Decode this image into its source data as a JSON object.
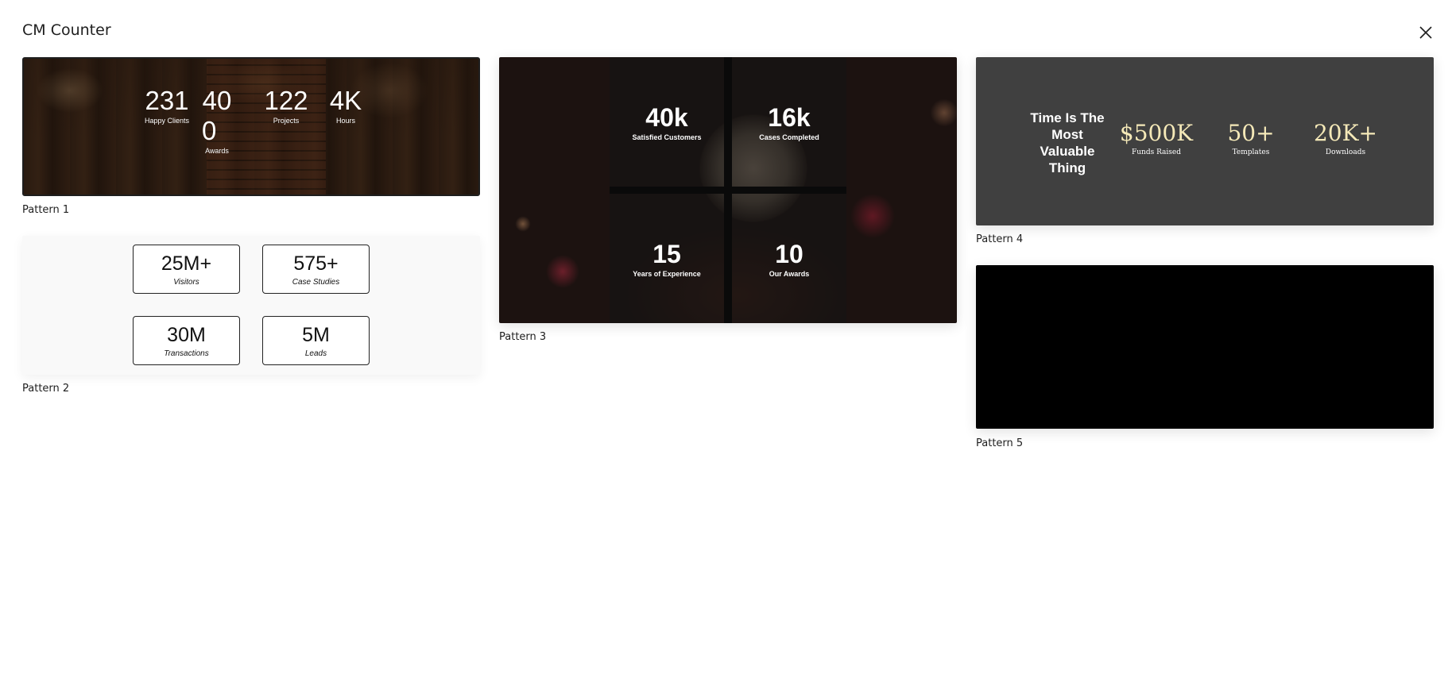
{
  "modal": {
    "title": "CM Counter",
    "close_icon": "close-icon"
  },
  "patterns": [
    {
      "label": "Pattern 1",
      "stats": [
        {
          "value": "231",
          "label": "Happy Clients"
        },
        {
          "value": "400",
          "value_line1": "40",
          "value_line2": "0",
          "label": "Awards"
        },
        {
          "value": "122",
          "label": "Projects"
        },
        {
          "value": "4K",
          "label": "Hours"
        }
      ]
    },
    {
      "label": "Pattern 2",
      "stats": [
        {
          "value": "25M+",
          "label": "Visitors"
        },
        {
          "value": "575+",
          "label": "Case Studies"
        },
        {
          "value": "30M",
          "label": "Transactions"
        },
        {
          "value": "5M",
          "label": "Leads"
        }
      ]
    },
    {
      "label": "Pattern 3",
      "stats": [
        {
          "value": "40k",
          "label": "Satisfied Customers"
        },
        {
          "value": "16k",
          "label": "Cases Completed"
        },
        {
          "value": "15",
          "label": "Years of Experience"
        },
        {
          "value": "10",
          "label": "Our Awards"
        }
      ]
    },
    {
      "label": "Pattern 4",
      "title": "Time Is The Most Valuable Thing",
      "stats": [
        {
          "value": "$500K",
          "label": "Funds Raised"
        },
        {
          "value": "50+",
          "label": "Templates"
        },
        {
          "value": "20K+",
          "label": "Downloads"
        }
      ],
      "colors": {
        "background": "#404040",
        "number": "#f5e9b8"
      }
    },
    {
      "label": "Pattern 5",
      "colors": {
        "background": "#000000"
      }
    }
  ]
}
